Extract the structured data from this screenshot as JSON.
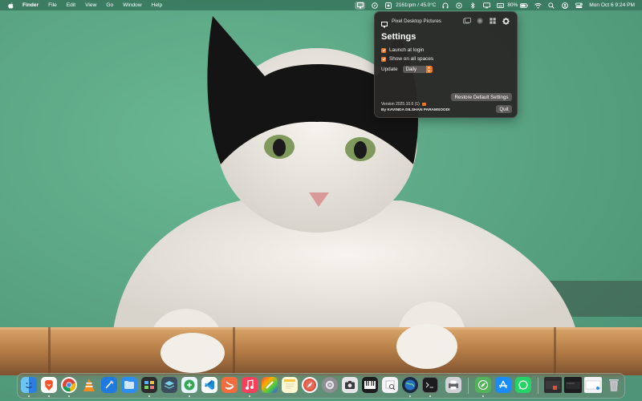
{
  "menubar": {
    "app_name": "Finder",
    "menus": [
      "File",
      "Edit",
      "View",
      "Go",
      "Window",
      "Help"
    ],
    "stats_text": "2161rpm / 45.0°C",
    "battery_percent": "80%",
    "clock": "Mon Oct 6  9:24 PM"
  },
  "panel": {
    "app_name": "Pixel Desktop Pictures",
    "title": "Settings",
    "launch_at_login_label": "Launch at login",
    "show_on_all_spaces_label": "Show on all spaces",
    "update_label": "Update",
    "update_value": "Daily",
    "restore_button": "Restore Default Settings",
    "version": "Version 2025.10.6 (1)",
    "author": "By KAVINDA DILSHAN PARAMSOODI",
    "quit_button": "Quit",
    "accent_color": "#e8782a"
  },
  "dock": {
    "apps": [
      "finder",
      "brave-browser",
      "chrome",
      "vlc",
      "xcode",
      "files",
      "mission-control",
      "layers",
      "app-store-connect",
      "visual-studio-code",
      "swift-playgrounds",
      "music",
      "notes-colors",
      "notes",
      "safari-compass",
      "system-settings",
      "screenshot",
      "piano",
      "preview",
      "globe",
      "terminal",
      "printer",
      "maps-compass",
      "app-store",
      "whatsapp",
      "window-1",
      "window-2",
      "window-3",
      "trash"
    ]
  }
}
